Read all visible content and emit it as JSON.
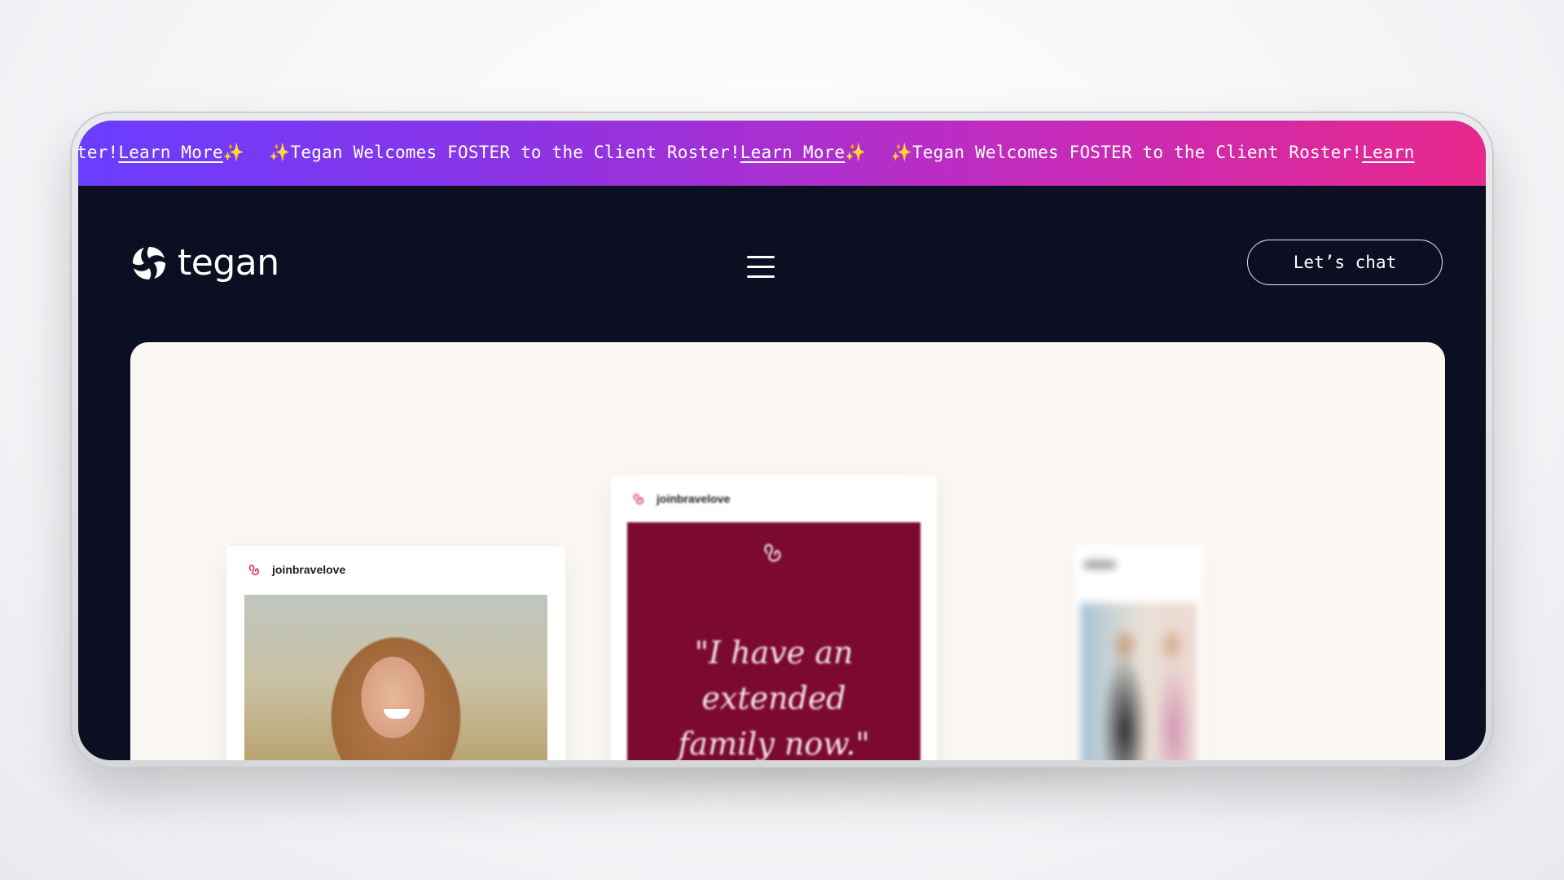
{
  "ticker": {
    "items": [
      {
        "text": "ter! ",
        "link": "Learn More",
        "sparkle_after": "✨"
      },
      {
        "sparkle_before": "✨",
        "text": "Tegan Welcomes FOSTER to the Client Roster! ",
        "link": "Learn More",
        "sparkle_after": "✨"
      },
      {
        "sparkle_before": "✨",
        "text": "Tegan Welcomes FOSTER to the Client Roster! ",
        "link": "Learn "
      }
    ]
  },
  "nav": {
    "logo_text": "tegan",
    "cta_label": "Let’s chat"
  },
  "posts": [
    {
      "username": "joinbravelove"
    },
    {
      "username": "joinbravelove",
      "quote": "\"I have an extended family now.\""
    }
  ],
  "colors": {
    "ticker_start": "#6a3dff",
    "ticker_end": "#e7288d",
    "nav_bg": "#0c0f22",
    "hero_bg": "#fbf8f3",
    "quote_panel": "#7b0a2e",
    "brand_accent": "#d8364f"
  },
  "icons": {
    "logo": "tegan-swirl-icon",
    "menu": "hamburger-icon",
    "avatar": "bravelove-heart-icon",
    "sparkle": "sparkle-icon"
  }
}
